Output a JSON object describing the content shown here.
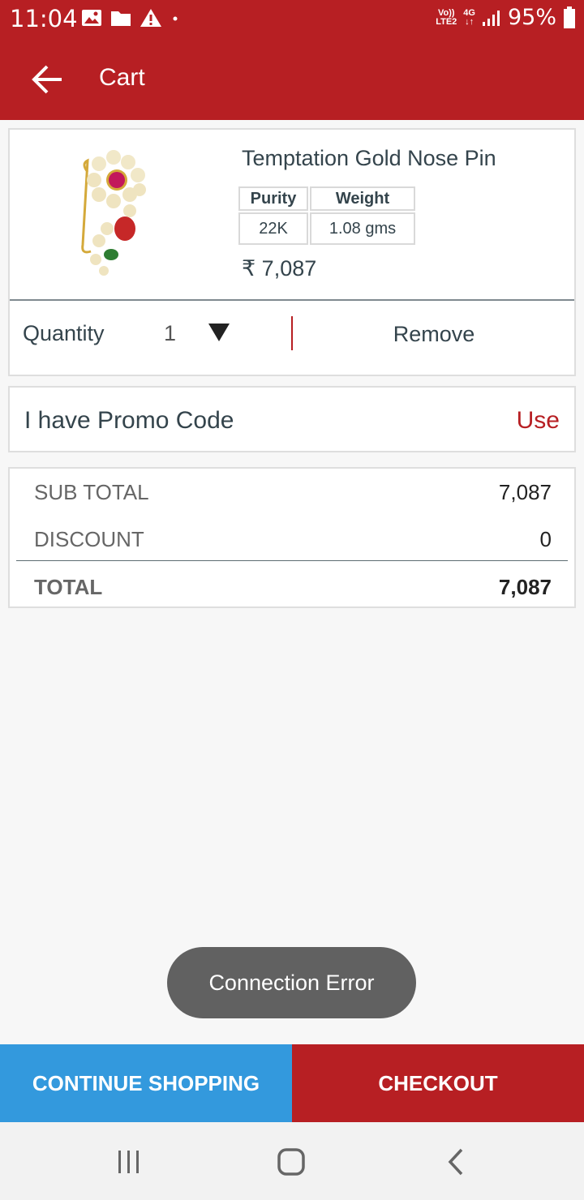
{
  "status_bar": {
    "time": "11:04",
    "network_top": "Vo))",
    "network_bottom": "LTE2",
    "signal_type": "4G",
    "battery": "95%"
  },
  "app_bar": {
    "title": "Cart",
    "back_icon": "arrow-left-icon"
  },
  "product": {
    "name": "Temptation Gold Nose Pin",
    "specs_headers": [
      "Purity",
      "Weight"
    ],
    "specs_values": [
      "22K",
      "1.08 gms"
    ],
    "price": "₹ 7,087",
    "quantity_label": "Quantity",
    "quantity_value": "1",
    "remove_label": "Remove"
  },
  "promo": {
    "label": "I have Promo Code",
    "action": "Use"
  },
  "totals": {
    "subtotal_label": "SUB TOTAL",
    "subtotal_value": "7,087",
    "discount_label": "DISCOUNT",
    "discount_value": "0",
    "total_label": "TOTAL",
    "total_value": "7,087"
  },
  "toast": {
    "message": "Connection Error"
  },
  "bottom_actions": {
    "continue_label": "CONTINUE SHOPPING",
    "checkout_label": "CHECKOUT"
  },
  "colors": {
    "brand_red": "#b71f23",
    "continue_blue": "#3399dd"
  }
}
